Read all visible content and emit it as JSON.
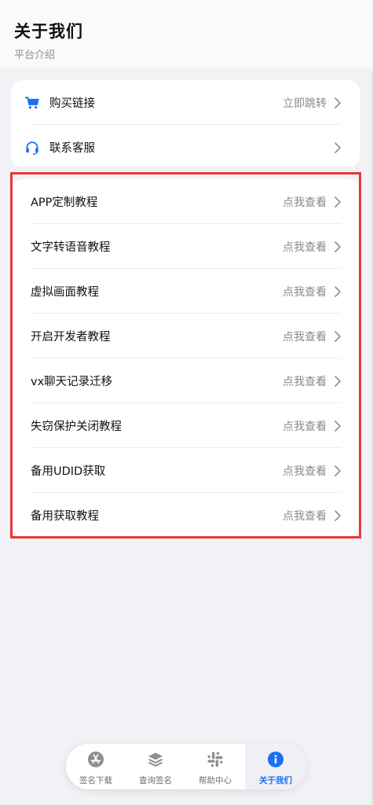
{
  "header": {
    "title": "关于我们",
    "subtitle": "平台介绍"
  },
  "links": [
    {
      "icon": "cart-icon",
      "label": "购买链接",
      "action": "立即跳转"
    },
    {
      "icon": "headset-icon",
      "label": "联系客服",
      "action": ""
    }
  ],
  "tutorials": [
    {
      "label": "APP定制教程",
      "action": "点我查看"
    },
    {
      "label": "文字转语音教程",
      "action": "点我查看"
    },
    {
      "label": "虚拟画面教程",
      "action": "点我查看"
    },
    {
      "label": "开启开发者教程",
      "action": "点我查看"
    },
    {
      "label": "vx聊天记录迁移",
      "action": "点我查看"
    },
    {
      "label": "失窃保护关闭教程",
      "action": "点我查看"
    },
    {
      "label": "备用UDID获取",
      "action": "点我查看"
    },
    {
      "label": "备用获取教程",
      "action": "点我查看"
    }
  ],
  "tabbar": [
    {
      "icon": "app-store-icon",
      "label": "签名下载",
      "active": false
    },
    {
      "icon": "layers-icon",
      "label": "查询签名",
      "active": false
    },
    {
      "icon": "slack-icon",
      "label": "帮助中心",
      "active": false
    },
    {
      "icon": "info-icon",
      "label": "关于我们",
      "active": true
    }
  ],
  "colors": {
    "accent": "#1d6ff2",
    "highlight_border": "#e8373a",
    "background": "#f2f2f6"
  }
}
